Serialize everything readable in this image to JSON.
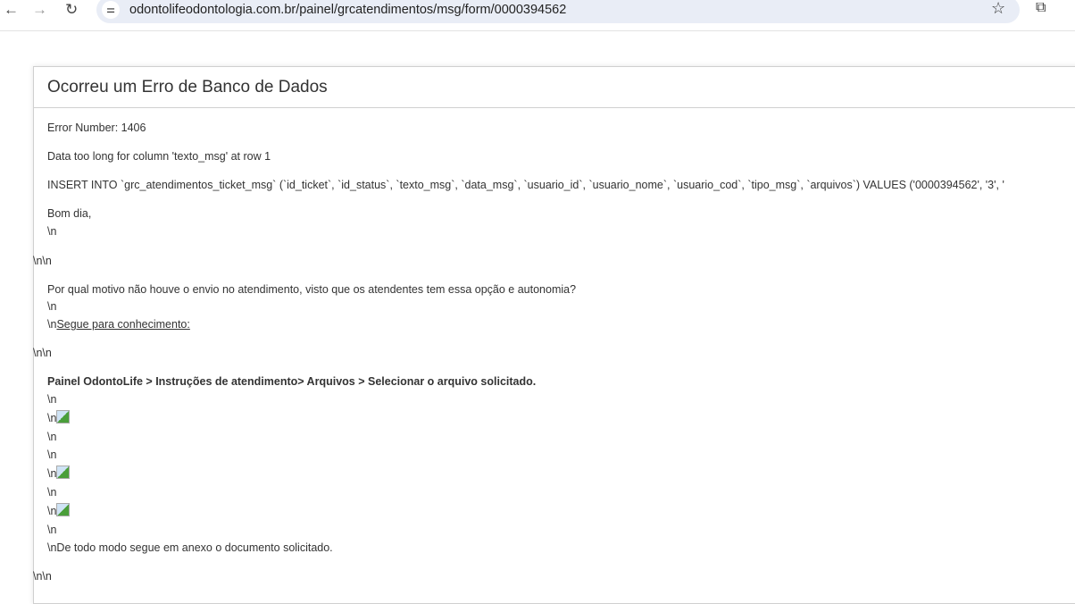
{
  "browser": {
    "url": "odontolifeodontologia.com.br/painel/grcatendimentos/msg/form/0000394562",
    "back_icon": "arrow-left",
    "forward_icon": "arrow-right",
    "reload_icon": "reload",
    "site_info_icon": "tune",
    "bookmark_icon": "star",
    "extensions_icon": "puzzle"
  },
  "error": {
    "title": "Ocorreu um Erro de Banco de Dados",
    "number": "Error Number: 1406",
    "message": "Data too long for column 'texto_msg' at row 1",
    "query": "INSERT INTO `grc_atendimentos_ticket_msg` (`id_ticket`, `id_status`, `texto_msg`, `data_msg`, `usuario_id`, `usuario_nome`, `usuario_cod`, `tipo_msg`, `arquivos`) VALUES ('0000394562', '3', '",
    "lines": {
      "greeting": "Bom dia,",
      "nl": "\\n",
      "nlnl": "\\n\\n",
      "question": "Por qual motivo não houve o envio no atendimento, visto que os atendentes tem essa opção e autonomia?",
      "segue_link": "Segue para conhecimento:",
      "path": "Painel OdontoLife > Instruções de atendimento> Arquivos > Selecionar o arquivo solicitado.",
      "closing": "\\nDe todo modo segue em anexo o documento solicitado."
    }
  }
}
